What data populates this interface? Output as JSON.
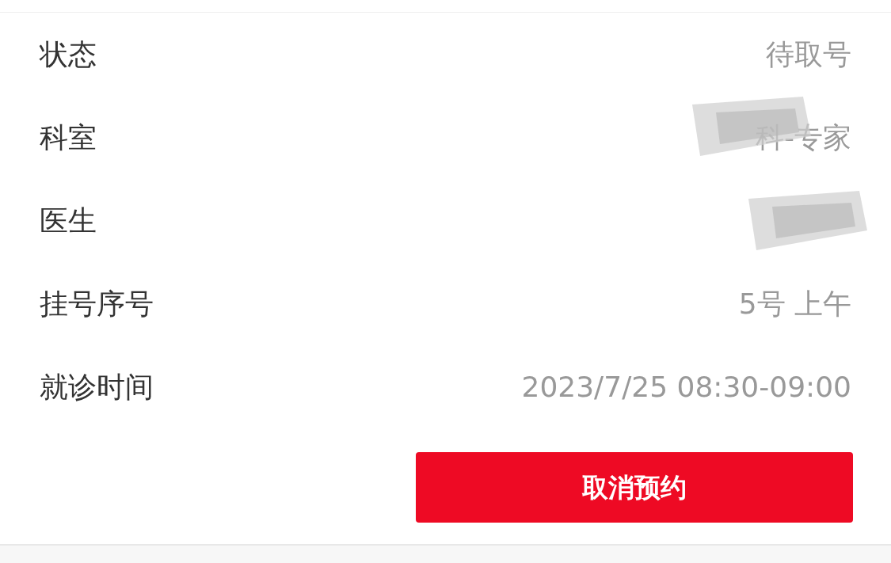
{
  "rows": [
    {
      "label": "状态",
      "value": "待取号"
    },
    {
      "label": "科室",
      "value": "科-专家",
      "redacted": true
    },
    {
      "label": "医生",
      "redacted": true
    },
    {
      "label": "挂号序号",
      "value": "5号 上午"
    },
    {
      "label": "就诊时间",
      "value": "2023/7/25 08:30-09:00"
    }
  ],
  "button": "取消预约"
}
